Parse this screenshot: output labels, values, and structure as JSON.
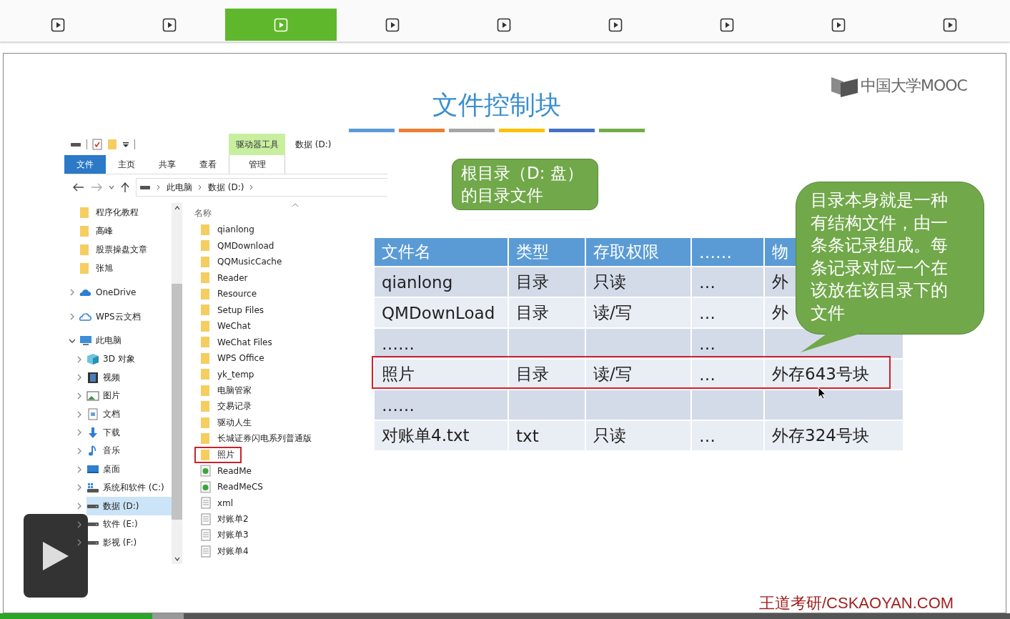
{
  "player_tabs": [
    {
      "selected": false
    },
    {
      "selected": false
    },
    {
      "selected": true
    },
    {
      "selected": false
    },
    {
      "selected": false
    },
    {
      "selected": false
    },
    {
      "selected": false
    },
    {
      "selected": false
    },
    {
      "selected": false
    }
  ],
  "slide": {
    "title": "文件控制块",
    "logo": "中国大学MOOC",
    "footer": "王道考研/CSKAOYAN.COM",
    "title_bars": [
      {
        "color": "#5b9bd5"
      },
      {
        "color": "#ed7d31"
      },
      {
        "color": "#a5a5a5"
      },
      {
        "color": "#ffc000"
      },
      {
        "color": "#4472c4"
      },
      {
        "color": "#70ad47"
      }
    ],
    "explorer": {
      "title": "数据 (D:)",
      "context_tab_group": "驱动器工具",
      "ribbon_tabs": [
        {
          "label": "文件",
          "selected": true
        },
        {
          "label": "主页",
          "selected": false
        },
        {
          "label": "共享",
          "selected": false
        },
        {
          "label": "查看",
          "selected": false
        },
        {
          "label": "管理",
          "selected": false
        }
      ],
      "address": [
        "此电脑",
        "数据 (D:)"
      ],
      "nav": [
        {
          "label": "程序化教程",
          "kind": "folder",
          "selected": false
        },
        {
          "label": "高峰",
          "kind": "folder",
          "selected": false
        },
        {
          "label": "股票操盘文章",
          "kind": "folder",
          "selected": false
        },
        {
          "label": "张旭",
          "kind": "folder",
          "selected": false
        },
        {
          "label": "OneDrive",
          "kind": "cloud",
          "selected": false,
          "expanded": false
        },
        {
          "label": "WPS云文档",
          "kind": "cloud-outline",
          "selected": false,
          "expanded": false
        },
        {
          "label": "此电脑",
          "kind": "pc",
          "selected": false,
          "expanded": true,
          "children": [
            {
              "label": "3D 对象",
              "kind": "cube",
              "selected": false,
              "expanded": false
            },
            {
              "label": "视频",
              "kind": "film",
              "selected": false,
              "expanded": false
            },
            {
              "label": "图片",
              "kind": "image",
              "selected": false,
              "expanded": false
            },
            {
              "label": "文档",
              "kind": "document",
              "selected": false,
              "expanded": false
            },
            {
              "label": "下载",
              "kind": "download",
              "selected": false,
              "expanded": false
            },
            {
              "label": "音乐",
              "kind": "music",
              "selected": false,
              "expanded": false
            },
            {
              "label": "桌面",
              "kind": "desktop",
              "selected": false,
              "expanded": false
            },
            {
              "label": "系统和软件 (C:)",
              "kind": "system-drive",
              "selected": false,
              "expanded": false
            },
            {
              "label": "数据 (D:)",
              "kind": "drive",
              "selected": true,
              "expanded": false
            },
            {
              "label": "软件 (E:)",
              "kind": "drive",
              "selected": false,
              "expanded": false
            },
            {
              "label": "影视 (F:)",
              "kind": "drive",
              "selected": false,
              "expanded": false
            }
          ]
        }
      ],
      "column_header": "名称",
      "files": [
        {
          "name": "qianlong",
          "kind": "folder",
          "highlighted": false
        },
        {
          "name": "QMDownload",
          "kind": "folder",
          "highlighted": false
        },
        {
          "name": "QQMusicCache",
          "kind": "folder",
          "highlighted": false
        },
        {
          "name": "Reader",
          "kind": "folder",
          "highlighted": false
        },
        {
          "name": "Resource",
          "kind": "folder",
          "highlighted": false
        },
        {
          "name": "Setup Files",
          "kind": "folder",
          "highlighted": false
        },
        {
          "name": "WeChat",
          "kind": "folder",
          "highlighted": false
        },
        {
          "name": "WeChat Files",
          "kind": "folder",
          "highlighted": false
        },
        {
          "name": "WPS Office",
          "kind": "folder",
          "highlighted": false
        },
        {
          "name": "yk_temp",
          "kind": "folder",
          "highlighted": false
        },
        {
          "name": "电脑管家",
          "kind": "folder",
          "highlighted": false
        },
        {
          "name": "交易记录",
          "kind": "folder",
          "highlighted": false
        },
        {
          "name": "驱动人生",
          "kind": "folder",
          "highlighted": false
        },
        {
          "name": "长城证券闪电系列普通版",
          "kind": "folder",
          "highlighted": false
        },
        {
          "name": "照片",
          "kind": "folder",
          "highlighted": true
        },
        {
          "name": "ReadMe",
          "kind": "web",
          "highlighted": false
        },
        {
          "name": "ReadMeCS",
          "kind": "web",
          "highlighted": false
        },
        {
          "name": "xml",
          "kind": "text",
          "highlighted": false
        },
        {
          "name": "对账单2",
          "kind": "text",
          "highlighted": false
        },
        {
          "name": "对账单3",
          "kind": "text",
          "highlighted": false
        },
        {
          "name": "对账单4",
          "kind": "text",
          "highlighted": false
        }
      ]
    },
    "callouts": [
      {
        "text": "根目录（D: 盘）的目录文件",
        "kind": "small"
      },
      {
        "text": "目录本身就是一种有结构文件，由一条条记录组成。每条记录对应一个在该放在该目录下的文件",
        "kind": "large"
      }
    ],
    "table": {
      "columns": [
        "文件名",
        "类型",
        "存取权限",
        "……",
        "物"
      ],
      "rows": [
        {
          "cells": [
            "qianlong",
            "目录",
            "只读",
            "…",
            "外"
          ],
          "highlighted": false
        },
        {
          "cells": [
            "QMDownLoad",
            "目录",
            "读/写",
            "…",
            "外"
          ],
          "highlighted": false
        },
        {
          "cells": [
            "……",
            null,
            null,
            "…",
            null
          ],
          "highlighted": false
        },
        {
          "cells": [
            "照片",
            "目录",
            "读/写",
            "…",
            "外存643号块"
          ],
          "highlighted": true
        },
        {
          "cells": [
            "……",
            null,
            null,
            null,
            null
          ],
          "highlighted": false
        },
        {
          "cells": [
            "对账单4.txt",
            "txt",
            "只读",
            "…",
            "外存324号块"
          ],
          "highlighted": false
        }
      ]
    }
  },
  "progress": {
    "played": {
      "level": 0.151
    },
    "buffered": {
      "level": 0.182
    }
  }
}
